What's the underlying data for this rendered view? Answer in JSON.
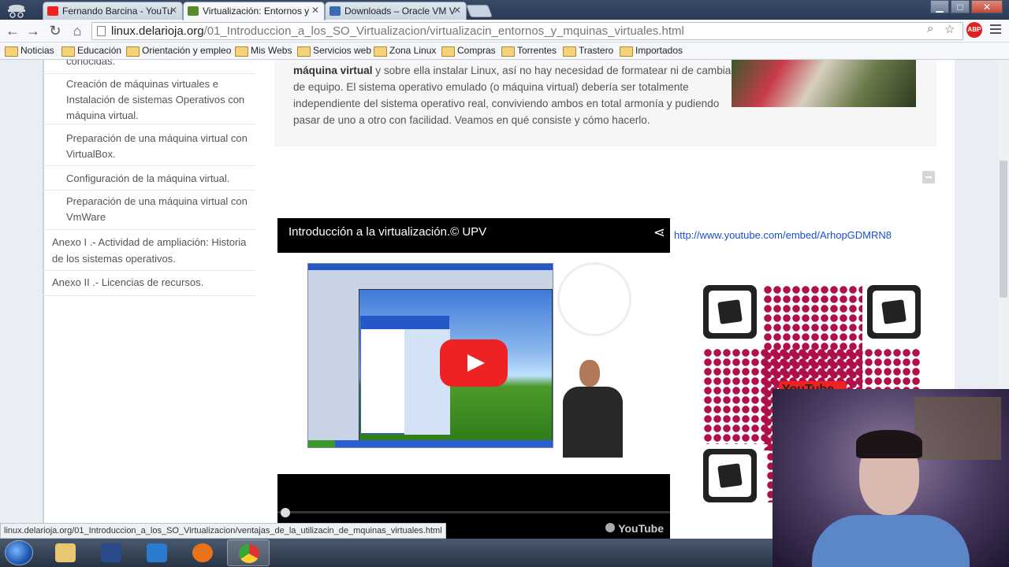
{
  "tabs": [
    {
      "label": "Fernando Barcina - YouTu",
      "favicon": "youtube-favicon",
      "active": false
    },
    {
      "label": "Virtualización: Entornos y",
      "favicon": "puzzle-favicon",
      "active": true
    },
    {
      "label": "Downloads – Oracle VM V",
      "favicon": "oracle-favicon",
      "active": false
    }
  ],
  "window_controls": {
    "minimize": "▁",
    "maximize": "□",
    "close": "✕"
  },
  "toolbar": {
    "back": "←",
    "forward": "→",
    "reload": "↻",
    "home": "⌂",
    "url_host": "linux.delarioja.org",
    "url_path": "/01_Introduccion_a_los_SO_Virtualizacion/virtualizacin_entornos_y_mquinas_virtuales.html",
    "abp_label": "ABP"
  },
  "bookmarks": [
    "Noticias",
    "Educación",
    "Orientación y empleo",
    "Mis Webs",
    "Servicios web",
    "Zona Linux",
    "Compras",
    "Torrentes",
    "Trastero",
    "Importados"
  ],
  "sidebar": {
    "sub_items": [
      "conocidas.",
      "Creación de máquinas virtuales e Instalación de sistemas Operativos con máquina virtual.",
      "Preparación de una máquina virtual con VirtualBox.",
      "Configuración de la máquina virtual.",
      "Preparación de una máquina virtual con VmWare"
    ],
    "main_items": [
      "Anexo I .- Actividad de ampliación: Historia de los sistemas operativos.",
      "Anexo II .- Licencias de recursos."
    ]
  },
  "panel": {
    "bold": "máquina virtual",
    "text": " y sobre ella instalar Linux, así no hay necesidad de formatear ni de cambiar de equipo. El sistema operativo emulado (o máquina virtual) debería ser totalmente independiente del sistema operativo real, conviviendo ambos en total armonía y pudiendo pasar de uno a otro con facilidad. Veamos en qué consiste y cómo hacerlo."
  },
  "video": {
    "title": "Introducción a la virtualización.© UPV",
    "brand": "YouTube"
  },
  "youtube_link": "http://www.youtube.com/embed/ArhopGDMRN8",
  "qr": {
    "badge": "YouTube"
  },
  "status_url": "linux.delarioja.org/01_Introduccion_a_los_SO_Virtualizacion/ventajas_de_la_utilizacin_de_mquinas_virtuales.html",
  "colors": {
    "link": "#1a4fd0",
    "play": "#e22222",
    "qr_dots": "#b0104a"
  }
}
